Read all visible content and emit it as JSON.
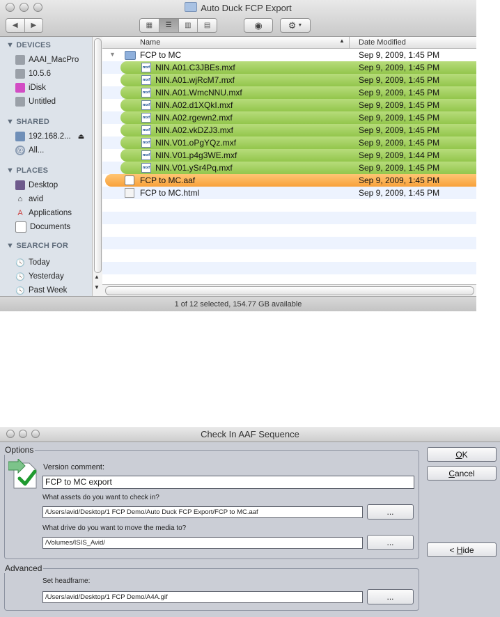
{
  "finder": {
    "window_title": "Auto Duck FCP Export",
    "toolbar": {
      "view_buttons": [
        "icon",
        "list",
        "column",
        "coverflow"
      ],
      "selected_view": "list"
    },
    "sidebar": {
      "sections": [
        {
          "title": "DEVICES",
          "items": [
            {
              "label": "AAAI_MacPro",
              "icon": "hard-drive-icon"
            },
            {
              "label": "10.5.6",
              "icon": "hard-drive-icon"
            },
            {
              "label": "iDisk",
              "icon": "idisk-icon"
            },
            {
              "label": "Untitled",
              "icon": "hard-drive-icon"
            }
          ]
        },
        {
          "title": "SHARED",
          "items": [
            {
              "label": "192.168.2...",
              "icon": "network-computer-icon"
            },
            {
              "label": "All...",
              "icon": "network-icon"
            }
          ]
        },
        {
          "title": "PLACES",
          "items": [
            {
              "label": "Desktop",
              "icon": "desktop-icon"
            },
            {
              "label": "avid",
              "icon": "home-icon"
            },
            {
              "label": "Applications",
              "icon": "applications-icon"
            },
            {
              "label": "Documents",
              "icon": "documents-icon"
            }
          ]
        },
        {
          "title": "SEARCH FOR",
          "items": [
            {
              "label": "Today",
              "icon": "clock-icon"
            },
            {
              "label": "Yesterday",
              "icon": "clock-icon"
            },
            {
              "label": "Past Week",
              "icon": "clock-icon"
            }
          ]
        }
      ]
    },
    "columns": {
      "name": "Name",
      "date": "Date Modified"
    },
    "rows": [
      {
        "name": "FCP to MC",
        "date": "Sep 9, 2009, 1:45 PM",
        "kind": "folder",
        "label": "none"
      },
      {
        "name": "NIN.A01.C3JBEs.mxf",
        "date": "Sep 9, 2009, 1:45 PM",
        "kind": "mxf",
        "label": "green"
      },
      {
        "name": "NIN.A01.wjRcM7.mxf",
        "date": "Sep 9, 2009, 1:45 PM",
        "kind": "mxf",
        "label": "green"
      },
      {
        "name": "NIN.A01.WmcNNU.mxf",
        "date": "Sep 9, 2009, 1:45 PM",
        "kind": "mxf",
        "label": "green"
      },
      {
        "name": "NIN.A02.d1XQkI.mxf",
        "date": "Sep 9, 2009, 1:45 PM",
        "kind": "mxf",
        "label": "green"
      },
      {
        "name": "NIN.A02.rgewn2.mxf",
        "date": "Sep 9, 2009, 1:45 PM",
        "kind": "mxf",
        "label": "green"
      },
      {
        "name": "NIN.A02.vkDZJ3.mxf",
        "date": "Sep 9, 2009, 1:45 PM",
        "kind": "mxf",
        "label": "green"
      },
      {
        "name": "NIN.V01.oPgYQz.mxf",
        "date": "Sep 9, 2009, 1:45 PM",
        "kind": "mxf",
        "label": "green"
      },
      {
        "name": "NIN.V01.p4g3WE.mxf",
        "date": "Sep 9, 2009, 1:44 PM",
        "kind": "mxf",
        "label": "green"
      },
      {
        "name": "NIN.V01.ySr4Pq.mxf",
        "date": "Sep 9, 2009, 1:45 PM",
        "kind": "mxf",
        "label": "green"
      },
      {
        "name": "FCP to MC.aaf",
        "date": "Sep 9, 2009, 1:45 PM",
        "kind": "aaf",
        "label": "orange"
      },
      {
        "name": "FCP to MC.html",
        "date": "Sep 9, 2009, 1:45 PM",
        "kind": "html",
        "label": "none"
      }
    ],
    "status": "1 of 12 selected, 154.77 GB available",
    "colors": {
      "green_label": "#a4d05e",
      "orange_label": "#f8a13a",
      "sidebar_bg": "#dde3ea"
    }
  },
  "dialog": {
    "title": "Check In AAF Sequence",
    "options_legend": "Options",
    "version_comment_label": "Version comment:",
    "version_comment_value": "FCP to MC export",
    "assets_label": "What assets do you want to check in?",
    "assets_value": "/Users/avid/Desktop/1 FCP Demo/Auto Duck FCP Export/FCP to MC.aaf",
    "drive_label": "What drive do you want to move the media to?",
    "drive_value": "/Volumes/ISIS_Avid/",
    "advanced_legend": "Advanced",
    "headframe_label": "Set headframe:",
    "headframe_value": "/Users/avid/Desktop/1 FCP Demo/A4A.gif",
    "browse_label": "...",
    "ok_prefix": "",
    "ok_accel": "O",
    "ok_rest": "K",
    "cancel_prefix": "",
    "cancel_accel": "C",
    "cancel_rest": "ancel",
    "hide_prefix": "< ",
    "hide_accel": "H",
    "hide_rest": "ide"
  }
}
